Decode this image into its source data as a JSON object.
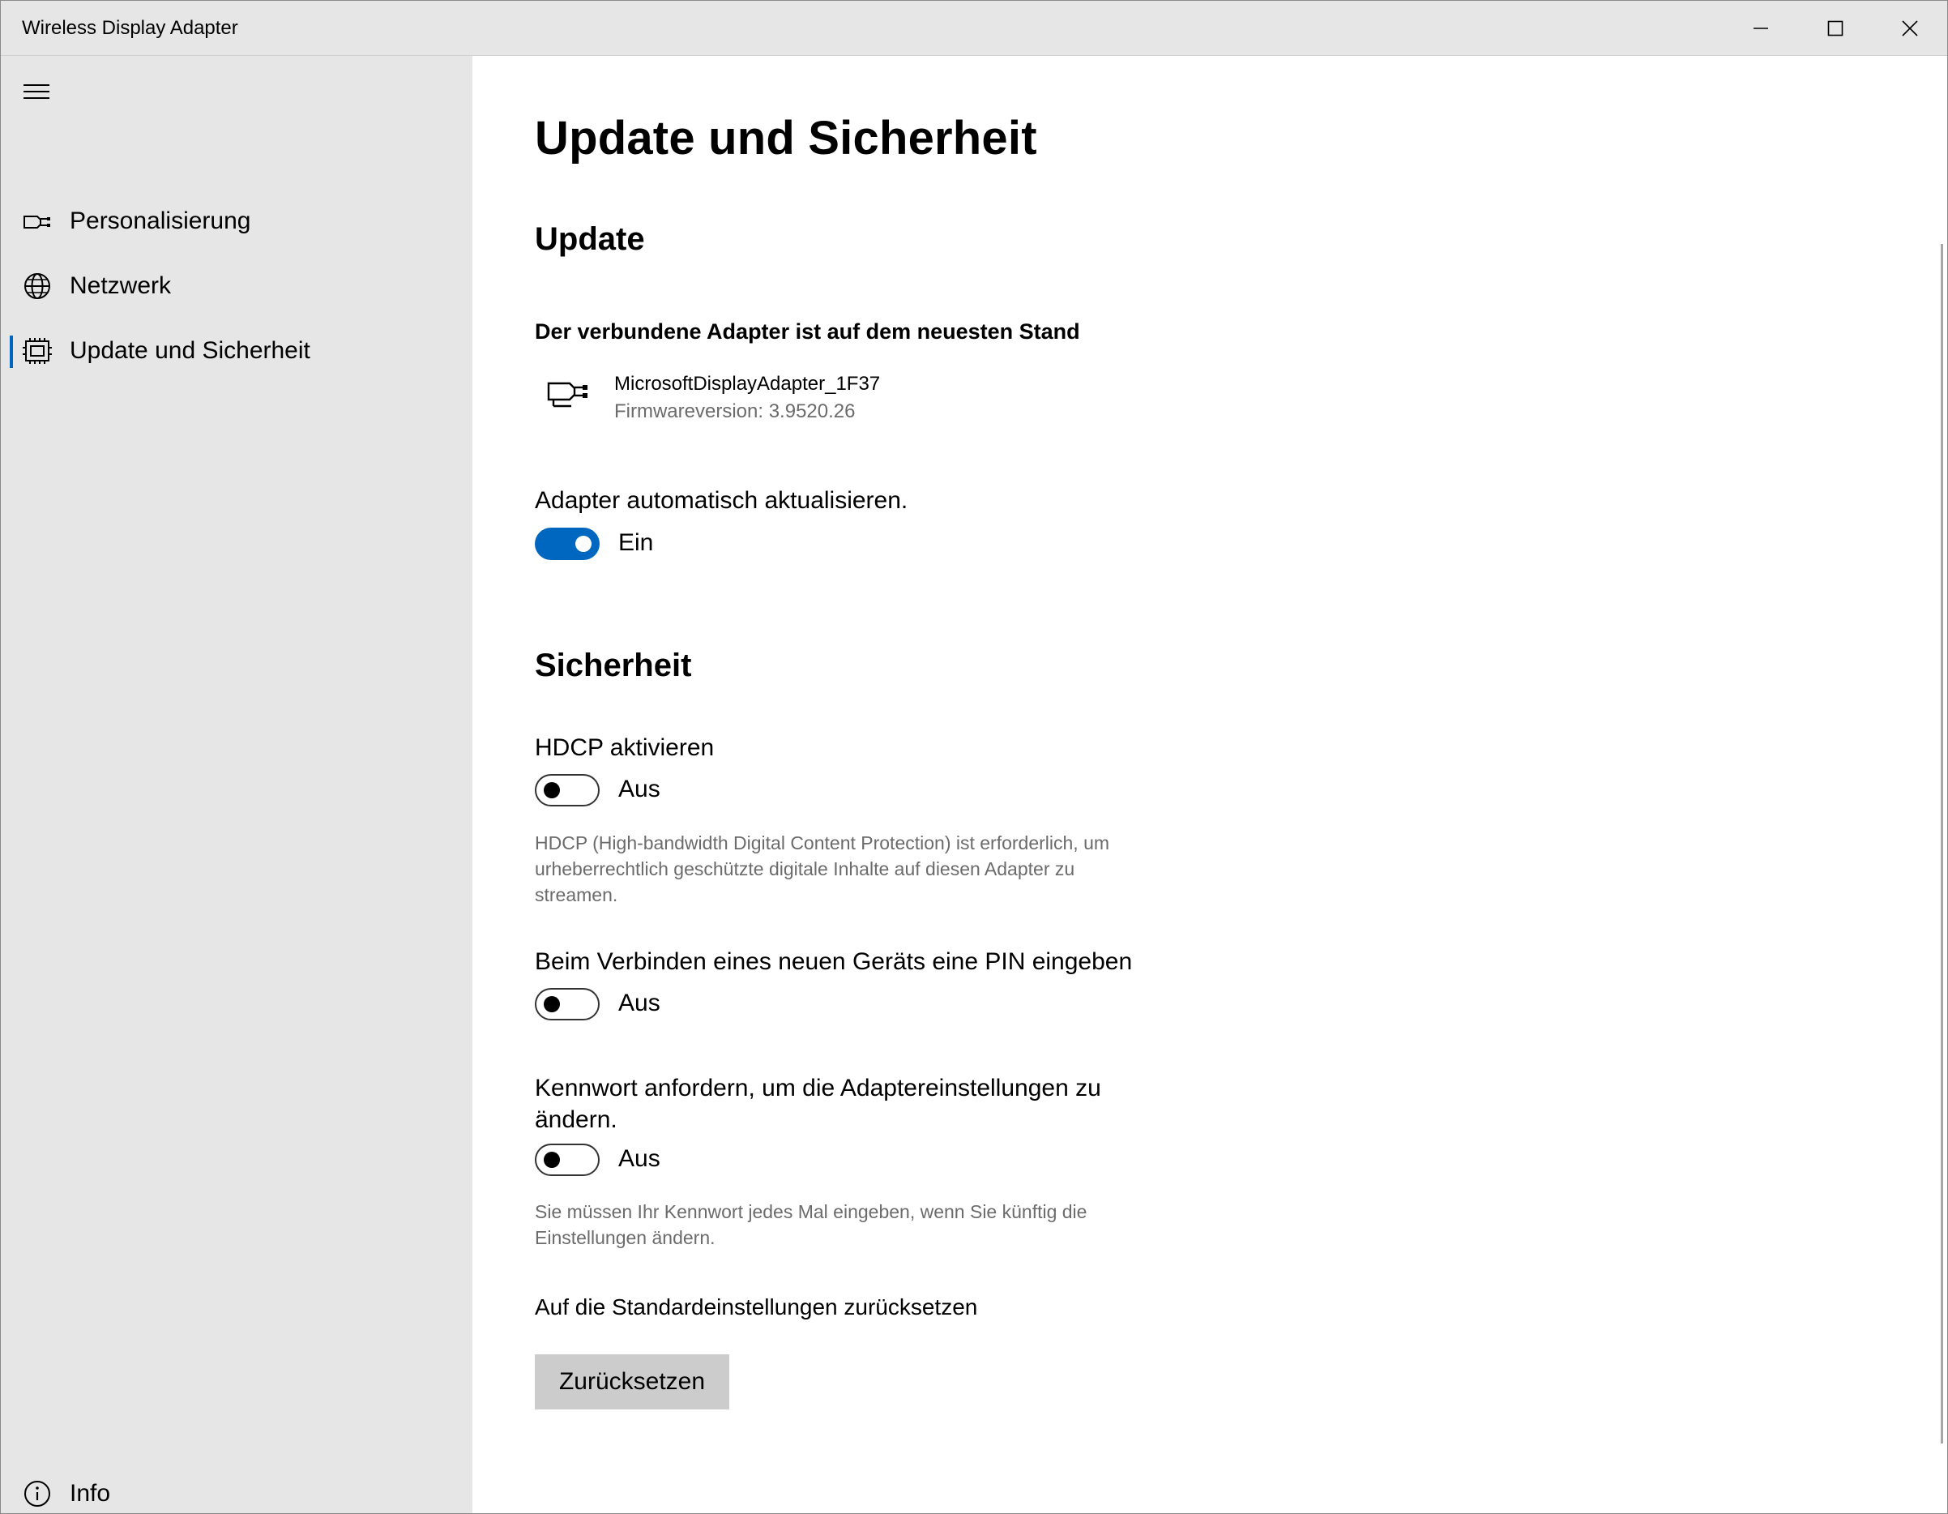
{
  "window": {
    "title": "Wireless Display Adapter"
  },
  "sidebar": {
    "items": [
      {
        "label": "Personalisierung",
        "icon": "personalization-icon",
        "active": false
      },
      {
        "label": "Netzwerk",
        "icon": "globe-icon",
        "active": false
      },
      {
        "label": "Update und Sicherheit",
        "icon": "chip-icon",
        "active": true
      }
    ],
    "info_label": "Info"
  },
  "main": {
    "page_title": "Update und Sicherheit",
    "update": {
      "heading": "Update",
      "status": "Der verbundene Adapter ist auf dem neuesten Stand",
      "device_name": "MicrosoftDisplayAdapter_1F37",
      "firmware": "Firmwareversion: 3.9520.26",
      "auto_update_label": "Adapter automatisch aktualisieren.",
      "auto_update_state": "Ein",
      "auto_update_on": true
    },
    "security": {
      "heading": "Sicherheit",
      "hdcp_label": "HDCP aktivieren",
      "hdcp_state": "Aus",
      "hdcp_on": false,
      "hdcp_desc": "HDCP (High-bandwidth Digital Content Protection) ist erforderlich, um urheberrechtlich geschützte digitale Inhalte auf diesen Adapter zu streamen.",
      "pin_label": "Beim Verbinden eines neuen Geräts eine PIN eingeben",
      "pin_state": "Aus",
      "pin_on": false,
      "password_label": "Kennwort anfordern, um die Adaptereinstellungen zu ändern.",
      "password_state": "Aus",
      "password_on": false,
      "password_desc": "Sie müssen Ihr Kennwort jedes Mal eingeben, wenn Sie künftig die Einstellungen ändern.",
      "reset_label": "Auf die Standardeinstellungen zurücksetzen",
      "reset_button": "Zurücksetzen"
    }
  },
  "colors": {
    "accent": "#0067c0",
    "sidebar_bg": "#e6e6e6",
    "muted_text": "#6b6b6b",
    "button_bg": "#cccccc"
  }
}
